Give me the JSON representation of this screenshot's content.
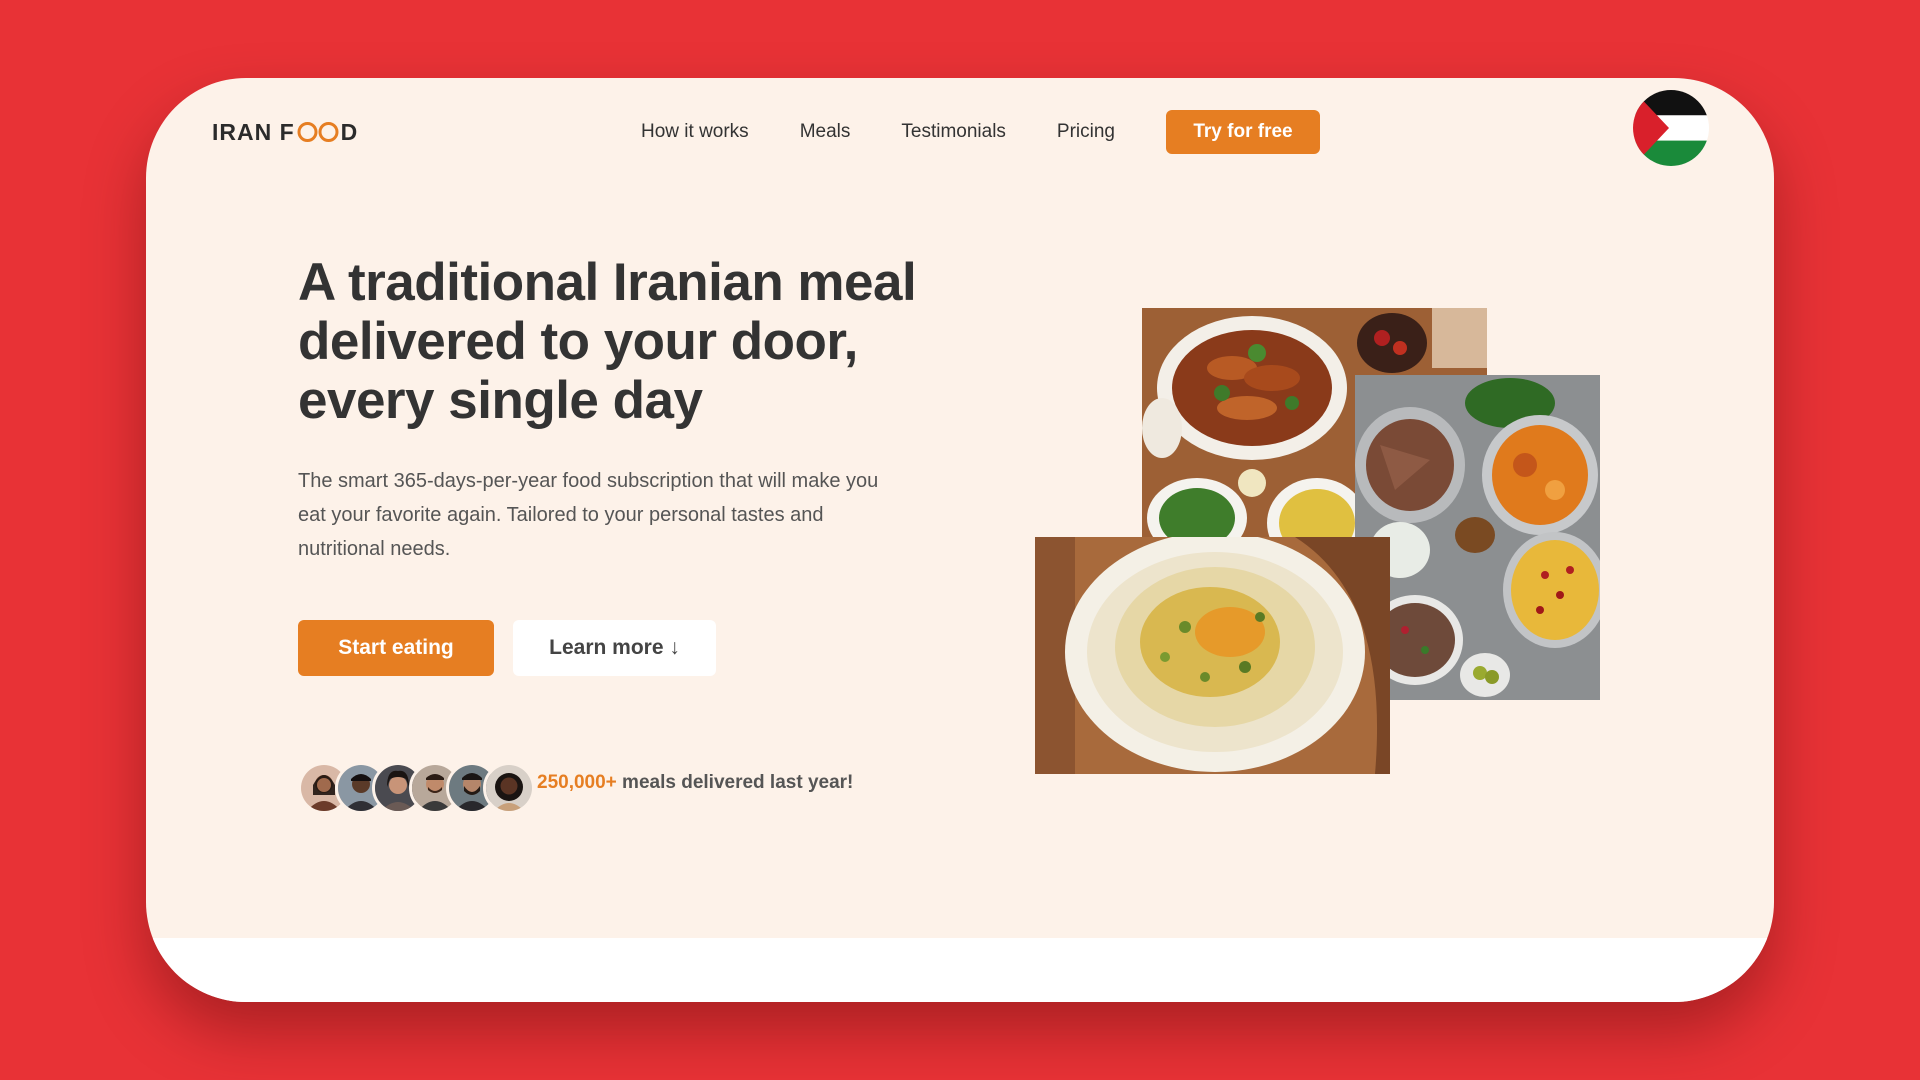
{
  "header": {
    "logo_text": "IRAN FOOD",
    "logo_prefix": "IRAN F",
    "logo_suffix": "D",
    "nav": [
      {
        "label": "How it works"
      },
      {
        "label": "Meals"
      },
      {
        "label": "Testimonials"
      },
      {
        "label": "Pricing"
      }
    ],
    "cta_label": "Try for free",
    "flag_icon": "palestine-flag-icon"
  },
  "hero": {
    "title": "A traditional Iranian meal delivered to your door, every single day",
    "subtitle": "The smart 365-days-per-year food subscription that will make you eat your favorite again. Tailored to your personal tastes and nutritional needs.",
    "primary_button": "Start eating",
    "secondary_button": "Learn more ↓",
    "delivered_count": "250,000+",
    "delivered_text": " meals delivered last year!"
  },
  "images": [
    {
      "name": "kebab-platter-image"
    },
    {
      "name": "stew-dishes-image"
    },
    {
      "name": "saffron-rice-image"
    }
  ],
  "colors": {
    "background": "#e83236",
    "card": "#fdf2e9",
    "accent": "#e67e22",
    "text": "#333333"
  }
}
